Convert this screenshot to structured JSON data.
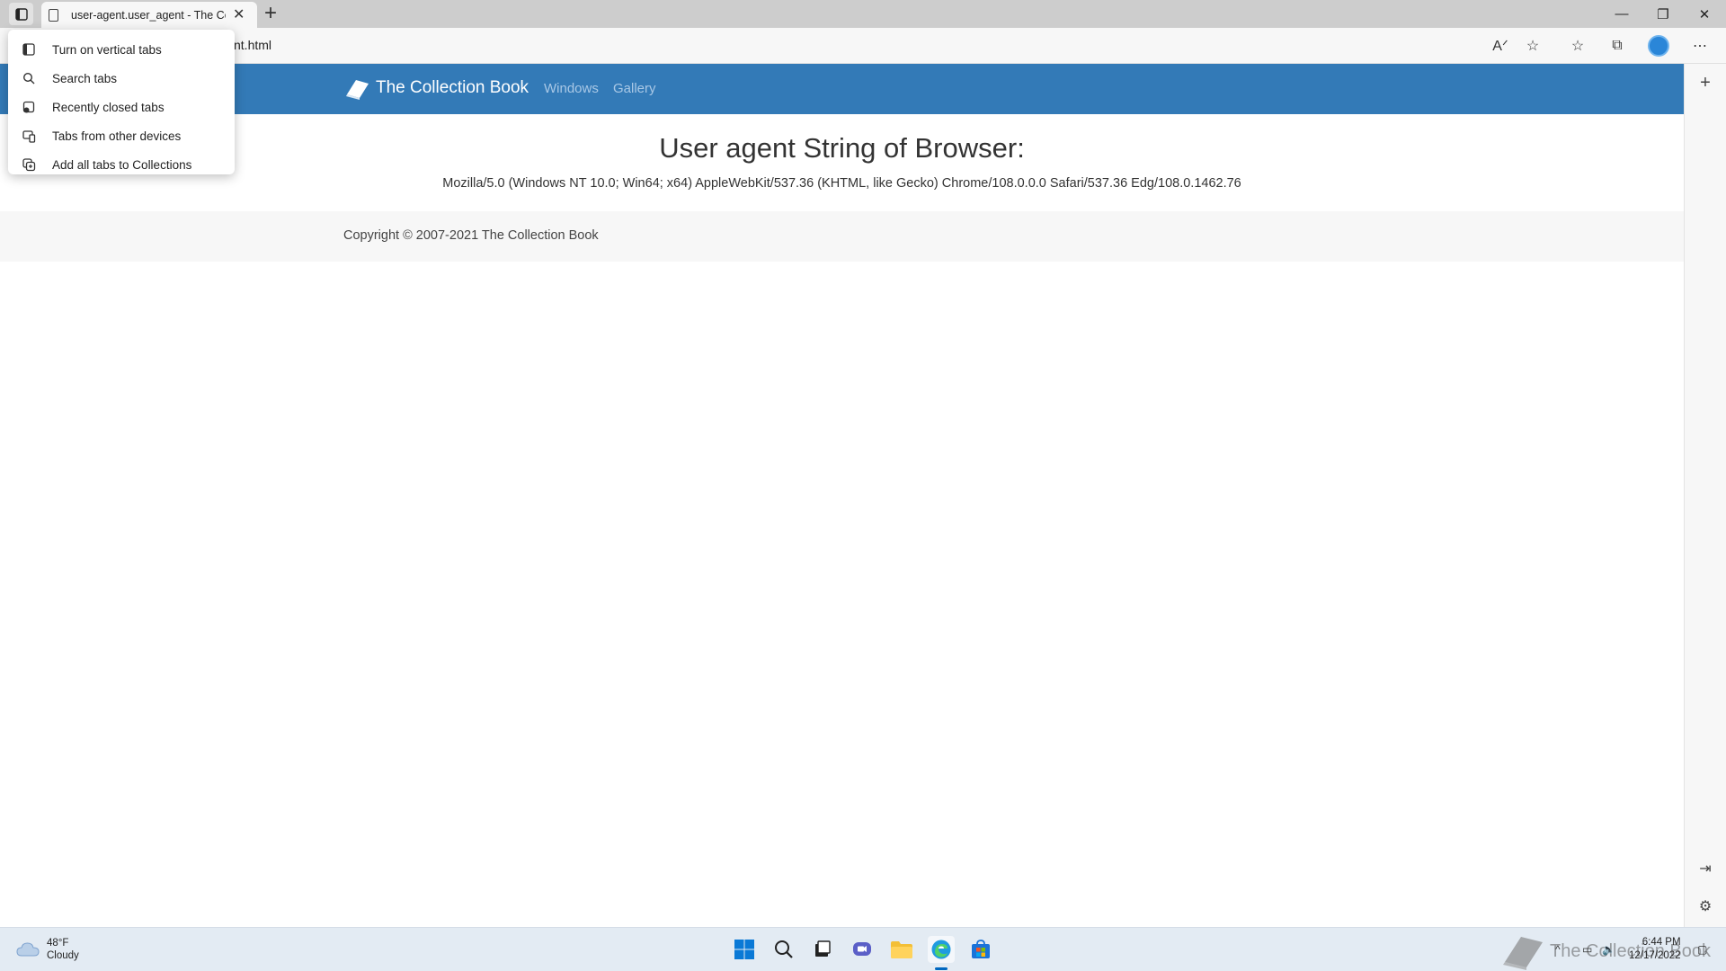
{
  "browser": {
    "tab_title": "user-agent.user_agent - The Coll",
    "url_visible": "nt.html"
  },
  "tab_menu": {
    "items": [
      {
        "label": "Turn on vertical tabs",
        "icon": "vertical-tabs-icon"
      },
      {
        "label": "Search tabs",
        "icon": "search-icon"
      },
      {
        "label": "Recently closed tabs",
        "icon": "recently-closed-icon"
      },
      {
        "label": "Tabs from other devices",
        "icon": "devices-icon"
      },
      {
        "label": "Add all tabs to Collections",
        "icon": "collections-icon"
      }
    ]
  },
  "site": {
    "brand": "The Collection Book",
    "nav": [
      "Windows",
      "Gallery"
    ],
    "heading": "User agent String of Browser:",
    "user_agent": "Mozilla/5.0 (Windows NT 10.0; Win64; x64) AppleWebKit/537.36 (KHTML, like Gecko) Chrome/108.0.0.0 Safari/537.36 Edg/108.0.1462.76",
    "footer": "Copyright © 2007-2021 The Collection Book"
  },
  "taskbar": {
    "temperature": "48°F",
    "condition": "Cloudy",
    "time": "6:44 PM",
    "date": "12/17/2022",
    "watermark": "The Collection Book"
  },
  "colors": {
    "navbar": "#337ab7",
    "accent": "#0067c0"
  }
}
